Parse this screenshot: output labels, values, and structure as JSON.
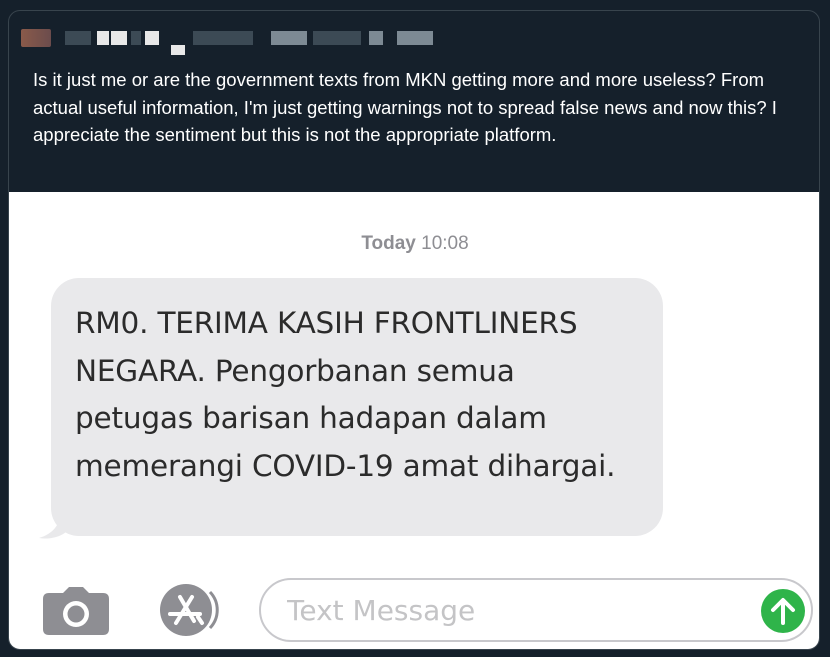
{
  "tweet": {
    "text": "Is it just me or are the government texts from MKN getting more and more useless? From actual useful information, I'm just getting warnings not to spread false news and now this? I appreciate the sentiment but this is not the appropriate platform."
  },
  "message_thread": {
    "timestamp_day": "Today",
    "timestamp_time": "10:08",
    "message": "RM0. TERIMA KASIH FRONTLINERS NEGARA. Pengorbanan semua petugas barisan hadapan dalam memerangi COVID-19 amat dihargai."
  },
  "compose": {
    "placeholder": "Text Message",
    "camera_icon": "camera-icon",
    "appstore_icon": "app-store-icon",
    "send_icon": "arrow-up-icon"
  },
  "colors": {
    "background": "#15202b",
    "bubble": "#e9e9eb",
    "send": "#2fb44a"
  }
}
